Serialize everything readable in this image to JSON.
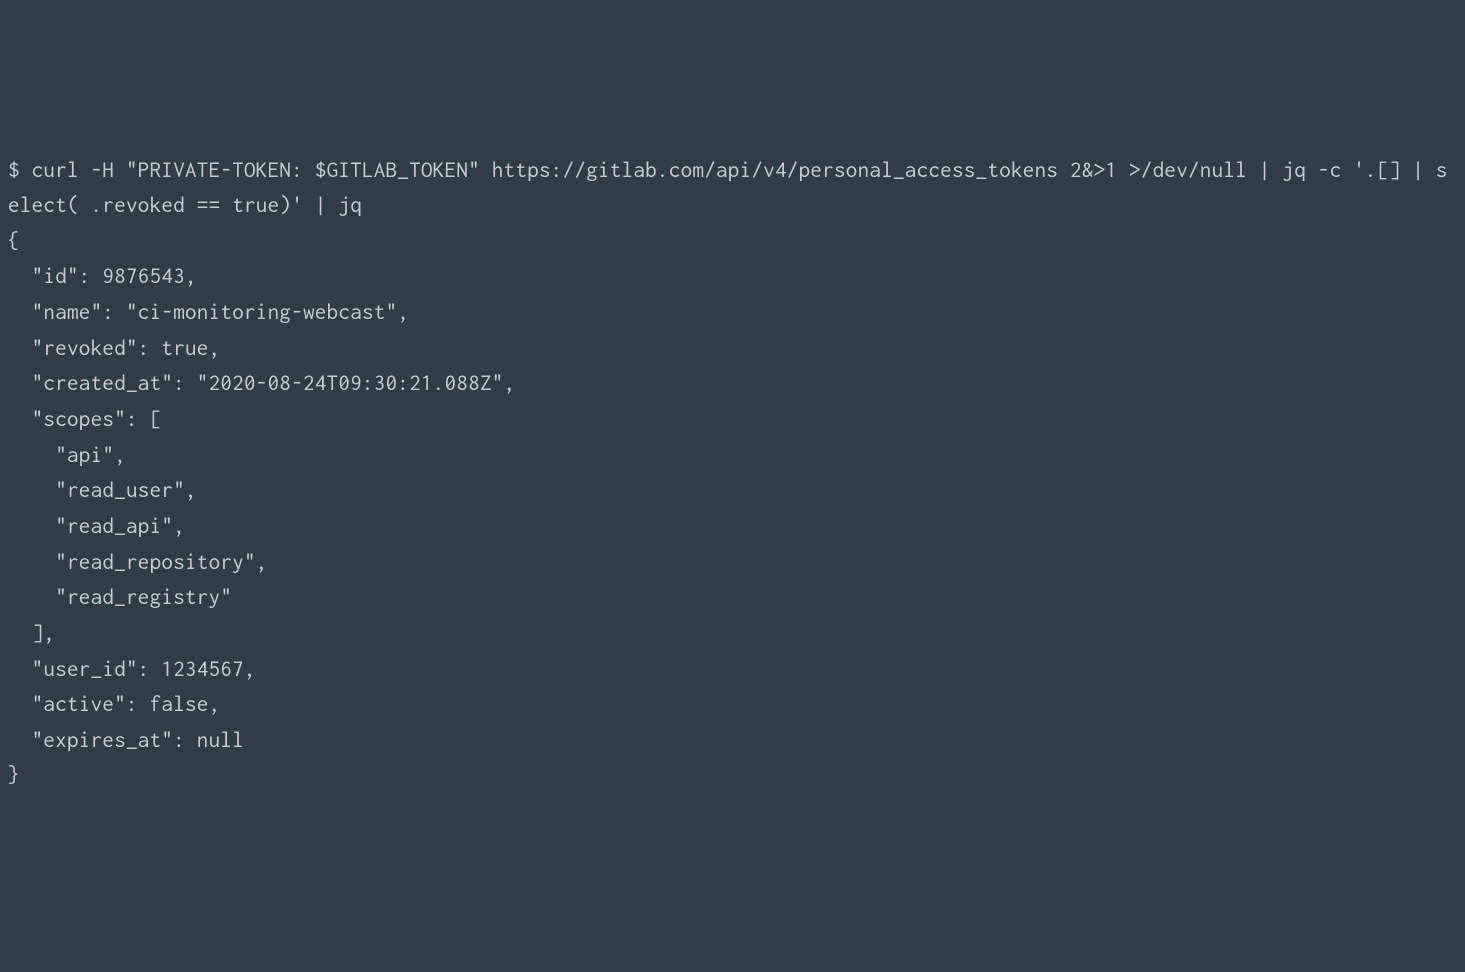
{
  "terminal": {
    "command_line1": "$ curl -H \"PRIVATE-TOKEN: $GITLAB_TOKEN\" https://gitlab.com/api/v4/personal_access_tokens 2&>1 >/dev/null | jq -c '.[] | select( .revoked == true)' | jq",
    "output_line1": "{",
    "output_line2": "  \"id\": 9876543,",
    "output_line3": "  \"name\": \"ci-monitoring-webcast\",",
    "output_line4": "  \"revoked\": true,",
    "output_line5": "  \"created_at\": \"2020-08-24T09:30:21.088Z\",",
    "output_line6": "  \"scopes\": [",
    "output_line7": "    \"api\",",
    "output_line8": "    \"read_user\",",
    "output_line9": "    \"read_api\",",
    "output_line10": "    \"read_repository\",",
    "output_line11": "    \"read_registry\"",
    "output_line12": "  ],",
    "output_line13": "  \"user_id\": 1234567,",
    "output_line14": "  \"active\": false,",
    "output_line15": "  \"expires_at\": null",
    "output_line16": "}"
  }
}
